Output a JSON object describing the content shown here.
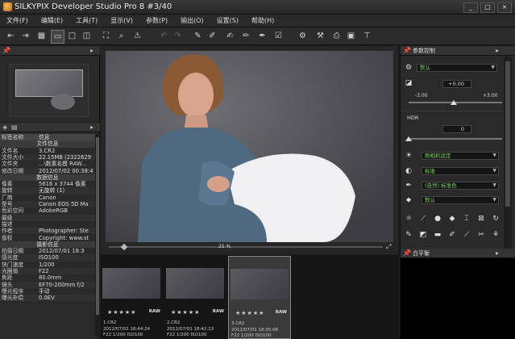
{
  "window": {
    "title": "SILKYPIX Developer Studio Pro 8    #3/40",
    "controls": [
      "_",
      "□",
      "×"
    ]
  },
  "menu": [
    "文件(F)",
    "编辑(E)",
    "工具(T)",
    "显示(V)",
    "参数(P)",
    "输出(O)",
    "设置(S)",
    "帮助(H)"
  ],
  "left_panel": {
    "header_label": "标签名称",
    "header_value": "信息",
    "file_section": "文件信息",
    "file_rows": [
      {
        "k": "文件名",
        "v": "3.CR2"
      },
      {
        "k": "文件大小",
        "v": "22.15MB (2322629"
      },
      {
        "k": "文件夹",
        "v": "...\\数素名模 RAW..."
      },
      {
        "k": "修改日期",
        "v": "2012/07/02 00:38:4"
      }
    ],
    "data_section": "数据信息",
    "data_rows": [
      {
        "k": "像素",
        "v": "5616 x 3744 像素"
      },
      {
        "k": "旋转",
        "v": "无旋转 (1)"
      },
      {
        "k": "厂商",
        "v": "Canon"
      },
      {
        "k": "型号",
        "v": "Canon EOS 5D Ma"
      },
      {
        "k": "色彩空间",
        "v": "AdobeRGB"
      },
      {
        "k": "最级",
        "v": ""
      },
      {
        "k": "描述",
        "v": ""
      },
      {
        "k": "作者",
        "v": "Photographer: Ste"
      },
      {
        "k": "版权",
        "v": "Copyright: www.st"
      }
    ],
    "shoot_section": "摄影信息",
    "shoot_rows": [
      {
        "k": "拍摄日期",
        "v": "2012/07/01 18:3"
      },
      {
        "k": "感光度",
        "v": "ISO100"
      },
      {
        "k": "快门速度",
        "v": "1/200"
      },
      {
        "k": "光圈值",
        "v": "F22"
      },
      {
        "k": "焦距",
        "v": "80.0mm"
      },
      {
        "k": "镜头",
        "v": "EF70-200mm f/2"
      },
      {
        "k": "曝光程序",
        "v": "手动"
      },
      {
        "k": "曝光补偿",
        "v": "0.0EV"
      }
    ]
  },
  "preview": {
    "zoom_label": "25 %"
  },
  "thumbnails": [
    {
      "stars": "★★★★★",
      "raw": "RAW",
      "name": "1.CR2",
      "info": "2012/07/01 18:44:24",
      "info2": "F22 1/200 ISO100"
    },
    {
      "stars": "★★★★★",
      "raw": "RAW",
      "name": "2.CR2",
      "info": "2012/07/01 18:42:13",
      "info2": "F22 1/200 ISO100"
    },
    {
      "stars": "★★★★★",
      "raw": "RAW",
      "name": "3.CR2",
      "info": "2012/07/01 18:35:06",
      "info2": "F22 1/200 ISO100"
    }
  ],
  "right_panel": {
    "title": "参数控制",
    "preset": "默认",
    "exposure_value": "+0.00",
    "exposure_min": "-3.00",
    "exposure_max": "+3.00",
    "hdr_label": "HDR",
    "hdr_value": "0",
    "wb_dropdown": "照相机设定",
    "tone_dropdown": "标准",
    "color_dropdown": "(自然) 标准色",
    "sharp_dropdown": "默认",
    "bottom_title": "白平衡"
  },
  "colors": {
    "accent_green": "#7fd36a",
    "panel_bg": "#2a2a2a"
  }
}
